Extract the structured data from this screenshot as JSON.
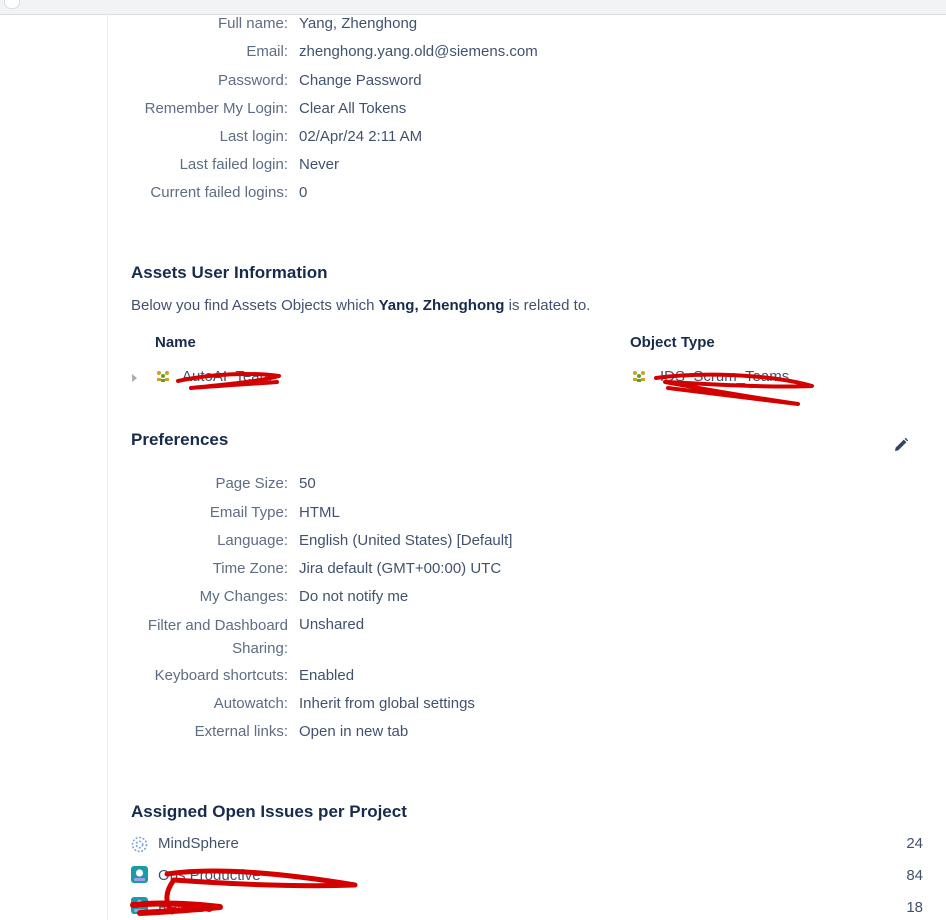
{
  "user": {
    "fields": [
      {
        "label": "Full name:",
        "value": "Yang, Zhenghong"
      },
      {
        "label": "Email:",
        "value": "zhenghong.yang.old@siemens.com"
      },
      {
        "label": "Password:",
        "value": "Change Password"
      },
      {
        "label": "Remember My Login:",
        "value": "Clear All Tokens"
      },
      {
        "label": "Last login:",
        "value": "02/Apr/24 2:11 AM"
      },
      {
        "label": "Last failed login:",
        "value": "Never"
      },
      {
        "label": "Current failed logins:",
        "value": "0"
      }
    ]
  },
  "assets": {
    "title": "Assets User Information",
    "desc_prefix": "Below you find Assets Objects which ",
    "desc_user": "Yang, Zhenghong",
    "desc_suffix": " is related to.",
    "col_name": "Name",
    "col_type": "Object Type",
    "row": {
      "name": "AutoAI_Team",
      "type": "IDS_Scrum_Teams"
    }
  },
  "preferences": {
    "title": "Preferences",
    "fields": [
      {
        "label": "Page Size:",
        "value": "50"
      },
      {
        "label": "Email Type:",
        "value": "HTML"
      },
      {
        "label": "Language:",
        "value": "English (United States) [Default]"
      },
      {
        "label": "Time Zone:",
        "value": "Jira default (GMT+00:00) UTC"
      },
      {
        "label": "My Changes:",
        "value": "Do not notify me"
      },
      {
        "label_line1": "Filter and Dashboard",
        "label_line2": "Sharing:",
        "value": "Unshared"
      },
      {
        "label": "Keyboard shortcuts:",
        "value": "Enabled"
      },
      {
        "label": "Autowatch:",
        "value": "Inherit from global settings"
      },
      {
        "label": "External links:",
        "value": "Open in new tab"
      }
    ]
  },
  "issues": {
    "title": "Assigned Open Issues per Project",
    "projects": [
      {
        "name": "MindSphere",
        "count": "24",
        "icon": "mindsphere-icon"
      },
      {
        "name": "Ops Productive",
        "count": "84",
        "icon": "project-avatar-icon"
      },
      {
        "name": "Release",
        "count": "18",
        "icon": "project-avatar-icon"
      }
    ]
  },
  "colors": {
    "heading": "#172b4d",
    "label": "#5e6c84",
    "value": "#42526e",
    "redaction": "#d40000"
  }
}
